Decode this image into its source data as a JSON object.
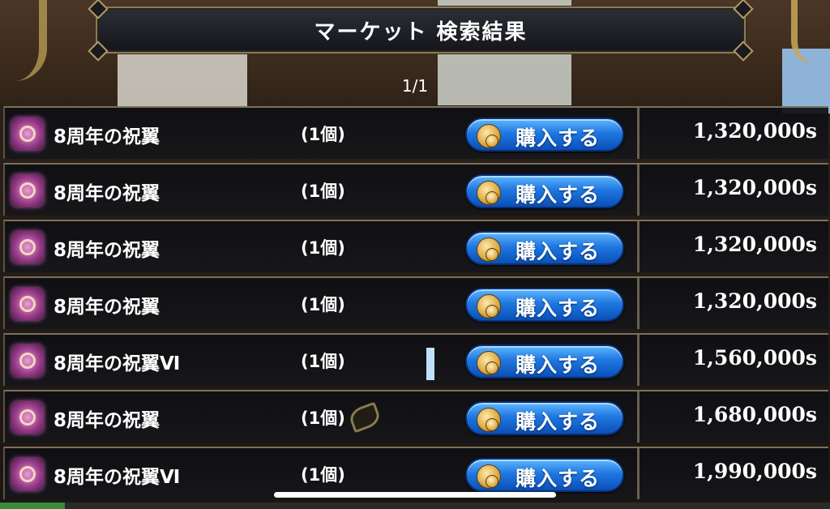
{
  "header": {
    "title": "マーケット 検索結果",
    "page_indicator": "1/1"
  },
  "listings": [
    {
      "name": "8周年の祝翼",
      "quantity": "(1個)",
      "buy_label": "購入する",
      "price": "1,320,000s"
    },
    {
      "name": "8周年の祝翼",
      "quantity": "(1個)",
      "buy_label": "購入する",
      "price": "1,320,000s"
    },
    {
      "name": "8周年の祝翼",
      "quantity": "(1個)",
      "buy_label": "購入する",
      "price": "1,320,000s"
    },
    {
      "name": "8周年の祝翼",
      "quantity": "(1個)",
      "buy_label": "購入する",
      "price": "1,320,000s"
    },
    {
      "name": "8周年の祝翼Ⅵ",
      "quantity": "(1個)",
      "buy_label": "購入する",
      "price": "1,560,000s"
    },
    {
      "name": "8周年の祝翼",
      "quantity": "(1個)",
      "buy_label": "購入する",
      "price": "1,680,000s"
    },
    {
      "name": "8周年の祝翼Ⅵ",
      "quantity": "(1個)",
      "buy_label": "購入する",
      "price": "1,990,000s"
    }
  ],
  "icons": {
    "item": "wing-item-icon",
    "currency": "coin-icon"
  },
  "colors": {
    "buy_button": "#1f78e0",
    "item_icon": "#9a3c8a",
    "frame": "#8a7a5a"
  }
}
